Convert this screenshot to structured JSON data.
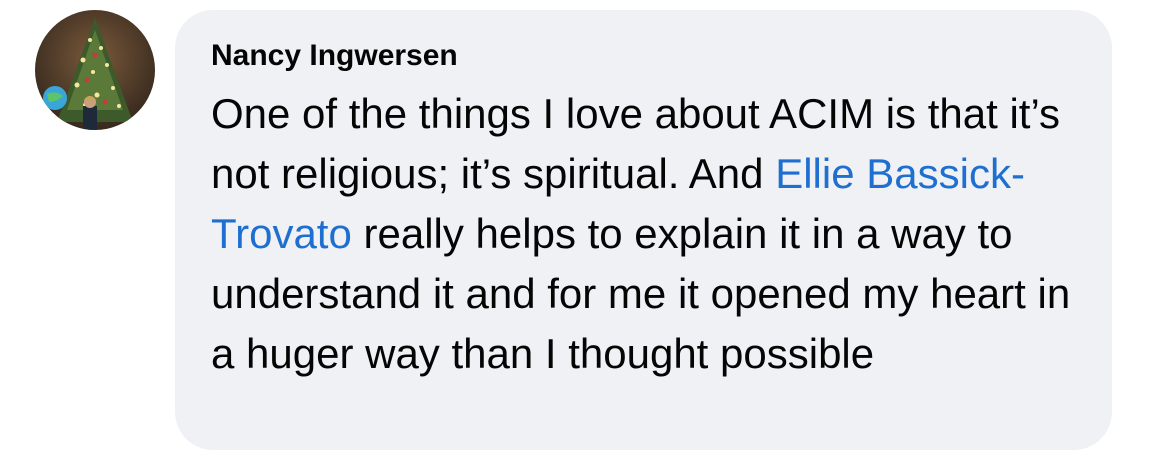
{
  "comment": {
    "author": "Nancy Ingwersen",
    "text_before_mention": "One of the things I love about ACIM is that it’s not religious; it’s spiritual. And ",
    "mention": "Ellie Bassick-Trovato",
    "text_after_mention": " really helps to explain it in a way to understand it and for me it opened my heart in a huger way than I thought possible"
  },
  "colors": {
    "bubble_background": "#eff1f4",
    "mention_link": "#1f6fd0",
    "text": "#050505"
  },
  "icons": {
    "avatar": "profile-photo-christmas-tree"
  }
}
